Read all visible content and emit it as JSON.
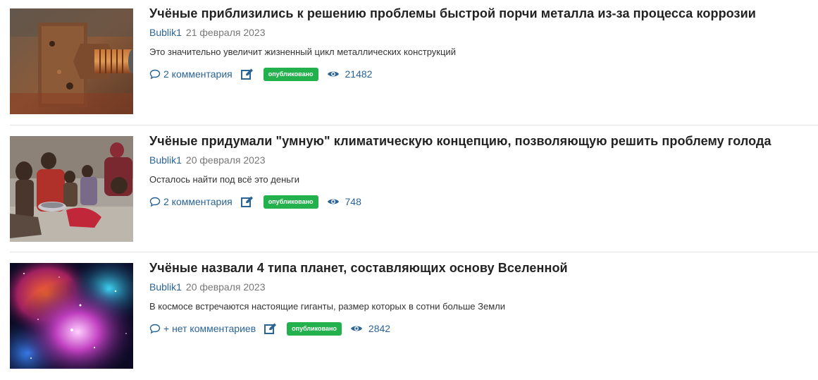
{
  "colors": {
    "link": "#2a6496",
    "badge": "#22b14c",
    "title": "#222222",
    "meta_date": "#777777"
  },
  "articles": [
    {
      "thumbnail": "rusty-bolt-image",
      "title": "Учёные приблизились к решению проблемы быстрой порчи металла из-за процесса коррозии",
      "author": "Bublik1",
      "date": "21 февраля 2023",
      "excerpt": "Это значительно увеличит жизненный цикл металлических конструкций",
      "comments": "2 комментария",
      "status": "опубликовано",
      "views": "21482"
    },
    {
      "thumbnail": "children-photo",
      "title": "Учёные придумали \"умную\" климатическую концепцию, позволяющую решить проблему голода",
      "author": "Bublik1",
      "date": "20 февраля 2023",
      "excerpt": "Осталось найти под всё это деньги",
      "comments": "2 комментария",
      "status": "опубликовано",
      "views": "748"
    },
    {
      "thumbnail": "nebula-space-image",
      "title": "Учёные назвали 4 типа планет, составляющих основу Вселенной",
      "author": "Bublik1",
      "date": "20 февраля 2023",
      "excerpt": "В космосе встречаются настоящие гиганты, размер которых в сотни больше Земли",
      "comments": "+ нет комментариев",
      "status": "опубликовано",
      "views": "2842"
    }
  ]
}
